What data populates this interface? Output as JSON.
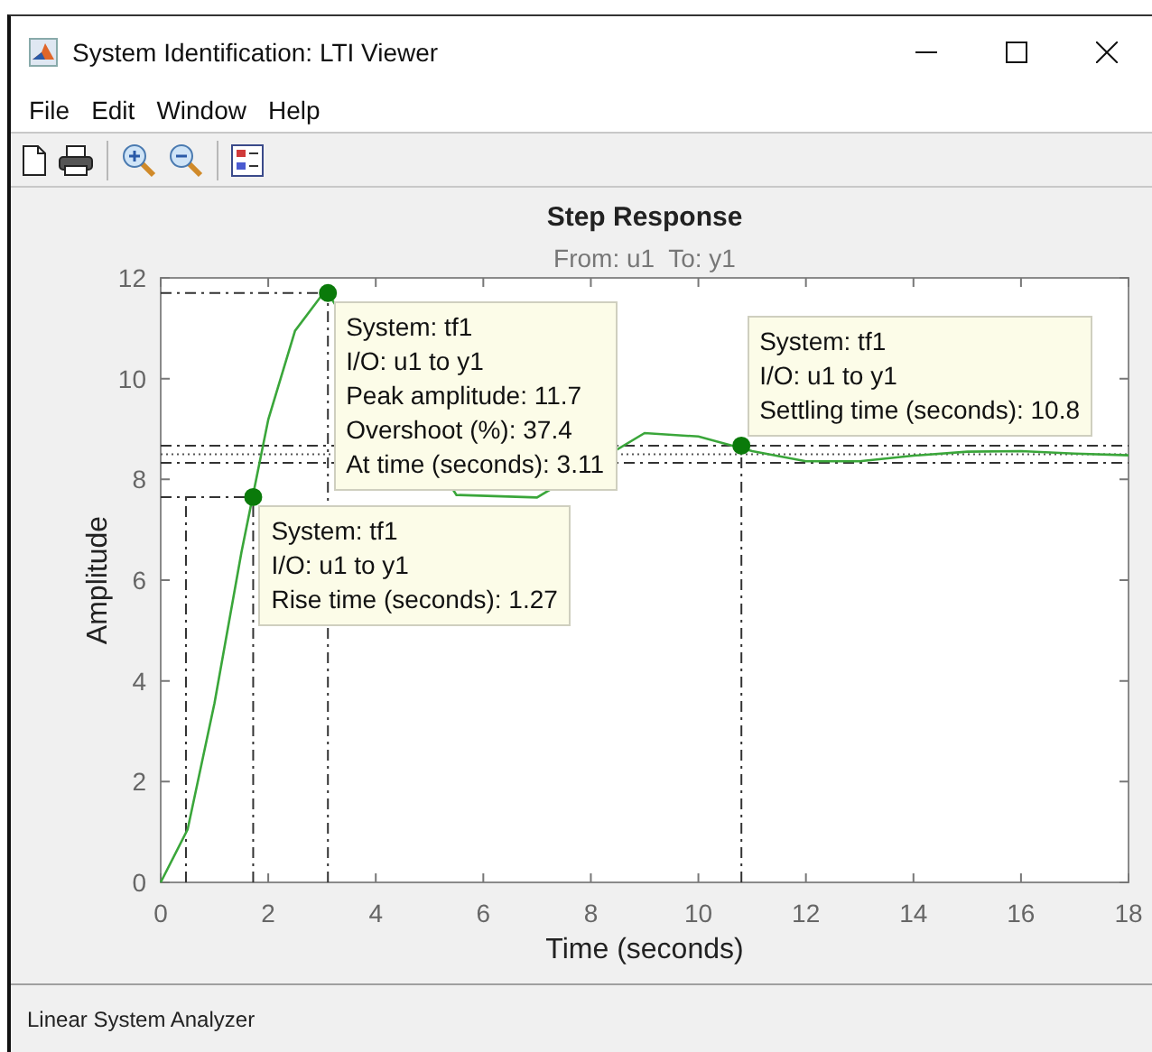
{
  "window": {
    "title": "System Identification: LTI Viewer"
  },
  "menu": [
    "File",
    "Edit",
    "Window",
    "Help"
  ],
  "plot": {
    "subtitle": "From: u1  To: y1",
    "chart_data": {
      "type": "line",
      "title": "Step Response",
      "xlabel": "Time (seconds)",
      "ylabel": "Amplitude",
      "x": [
        0,
        0.5,
        1,
        1.5,
        2,
        2.5,
        3,
        3.11,
        5.5,
        7,
        9,
        10,
        11,
        12,
        13,
        14,
        15,
        16,
        17,
        18
      ],
      "series": [
        {
          "color": "#3aa63a",
          "values": [
            0,
            1.05,
            3.56,
            6.55,
            9.19,
            10.95,
            11.66,
            11.7,
            7.69,
            7.64,
            8.92,
            8.85,
            8.56,
            8.36,
            8.36,
            8.47,
            8.55,
            8.56,
            8.51,
            8.48
          ]
        }
      ],
      "xlim": [
        0,
        18
      ],
      "ylim": [
        0,
        12
      ],
      "xticks": [
        0,
        2,
        4,
        6,
        8,
        10,
        12,
        14,
        16,
        18
      ],
      "yticks": [
        0,
        2,
        4,
        6,
        8,
        10,
        12
      ],
      "ref_lines": [
        {
          "axis": "x",
          "value": 0.47
        },
        {
          "axis": "y",
          "value": 8.5
        }
      ]
    },
    "datatips": [
      {
        "lines": [
          "System: tf1",
          "I/O: u1 to y1",
          "Peak amplitude: 11.7",
          "Overshoot (%): 37.4",
          "At time (seconds): 3.11"
        ]
      },
      {
        "lines": [
          "System: tf1",
          "I/O: u1 to y1",
          "Rise time (seconds): 1.27"
        ]
      },
      {
        "lines": [
          "System: tf1",
          "I/O: u1 to y1",
          "Settling time (seconds): 10.8"
        ]
      }
    ]
  },
  "status_bar": "Linear System Analyzer"
}
